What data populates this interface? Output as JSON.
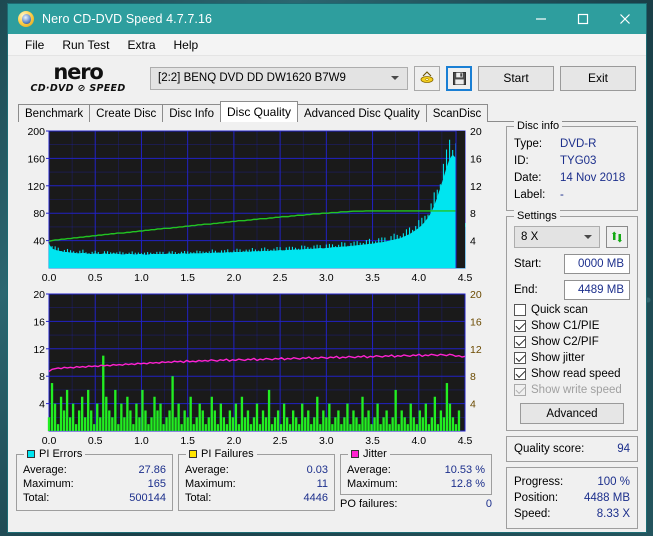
{
  "window": {
    "title": "Nero CD-DVD Speed 4.7.7.16",
    "icon": "nero-disc-icon",
    "minimize": "minimize-icon",
    "maximize": "maximize-icon",
    "close": "close-icon"
  },
  "menu": {
    "items": [
      {
        "label": "File"
      },
      {
        "label": "Run Test"
      },
      {
        "label": "Extra"
      },
      {
        "label": "Help"
      }
    ]
  },
  "toolbar": {
    "brand_top": "nero",
    "brand_bottom": "CD·DVD ⊘ SPEED",
    "drive": "[2:2]   BENQ DVD DD DW1620 B7W9",
    "eject_icon": "eject-disc-icon",
    "save_icon": "save-floppy-icon",
    "start_label": "Start",
    "exit_label": "Exit"
  },
  "tabs": [
    {
      "label": "Benchmark",
      "active": false
    },
    {
      "label": "Create Disc",
      "active": false
    },
    {
      "label": "Disc Info",
      "active": false
    },
    {
      "label": "Disc Quality",
      "active": true
    },
    {
      "label": "Advanced Disc Quality",
      "active": false
    },
    {
      "label": "ScanDisc",
      "active": false
    }
  ],
  "disc_info": {
    "legend": "Disc info",
    "rows": [
      {
        "key": "Type:",
        "value": "DVD-R"
      },
      {
        "key": "ID:",
        "value": "TYG03"
      },
      {
        "key": "Date:",
        "value": "14 Nov 2018"
      },
      {
        "key": "Label:",
        "value": "-"
      }
    ]
  },
  "settings": {
    "legend": "Settings",
    "speed": "8 X",
    "refresh_icon": "refresh-arrows-icon",
    "start_label": "Start:",
    "start_value": "0000 MB",
    "end_label": "End:",
    "end_value": "4489 MB",
    "checkboxes": [
      {
        "label": "Quick scan",
        "checked": false,
        "disabled": false
      },
      {
        "label": "Show C1/PIE",
        "checked": true,
        "disabled": false
      },
      {
        "label": "Show C2/PIF",
        "checked": true,
        "disabled": false
      },
      {
        "label": "Show jitter",
        "checked": true,
        "disabled": false
      },
      {
        "label": "Show read speed",
        "checked": true,
        "disabled": false
      },
      {
        "label": "Show write speed",
        "checked": true,
        "disabled": true
      }
    ],
    "advanced_label": "Advanced"
  },
  "quality": {
    "label": "Quality score:",
    "value": "94"
  },
  "progress": {
    "rows": [
      {
        "key": "Progress:",
        "value": "100 %"
      },
      {
        "key": "Position:",
        "value": "4488 MB"
      },
      {
        "key": "Speed:",
        "value": "8.33 X"
      }
    ]
  },
  "stats": {
    "pi_errors": {
      "legend": "PI Errors",
      "color": "#00e5f0",
      "rows": [
        {
          "key": "Average:",
          "value": "27.86"
        },
        {
          "key": "Maximum:",
          "value": "165"
        },
        {
          "key": "Total:",
          "value": "500144"
        }
      ]
    },
    "pi_failures": {
      "legend": "PI Failures",
      "color": "#ffe400",
      "rows": [
        {
          "key": "Average:",
          "value": "0.03"
        },
        {
          "key": "Maximum:",
          "value": "11"
        },
        {
          "key": "Total:",
          "value": "4446"
        }
      ]
    },
    "jitter": {
      "legend": "Jitter",
      "color": "#ff22d0",
      "rows": [
        {
          "key": "Average:",
          "value": "10.53 %"
        },
        {
          "key": "Maximum:",
          "value": "12.8 %"
        }
      ],
      "po_label": "PO failures:",
      "po_value": "0"
    }
  },
  "chart_data": [
    {
      "type": "area",
      "name": "pie-chart",
      "title": "PI Errors / read speed",
      "xlabel": "",
      "ylabel": "PI Errors",
      "x_ticks": [
        "0.0",
        "0.5",
        "1.0",
        "1.5",
        "2.0",
        "2.5",
        "3.0",
        "3.5",
        "4.0",
        "4.5"
      ],
      "xlim": [
        0,
        4.5
      ],
      "y_ticks_left": [
        "40",
        "80",
        "120",
        "160",
        "200"
      ],
      "ylim_left": [
        0,
        200
      ],
      "y_ticks_right": [
        "4",
        "8",
        "12",
        "16",
        "20"
      ],
      "ylim_right": [
        0,
        20
      ],
      "grid": true,
      "background": "#1a1a1a",
      "grid_color": "#2222cc",
      "series": [
        {
          "name": "PI Errors",
          "color": "#00e5f0",
          "kind": "area",
          "axis": "left",
          "values": [
            34,
            28,
            26,
            25,
            24,
            23,
            23,
            22,
            22,
            21,
            21,
            22,
            21,
            20,
            20,
            21,
            20,
            20,
            21,
            20,
            20,
            21,
            20,
            20,
            19,
            20,
            20,
            20,
            19,
            20,
            20,
            19,
            19,
            20,
            20,
            20,
            20,
            20,
            20,
            21,
            20,
            20,
            20,
            21,
            21,
            20,
            21,
            21,
            21,
            21,
            21,
            22,
            21,
            22,
            22,
            22,
            22,
            22,
            23,
            22,
            23,
            23,
            23,
            23,
            24,
            23,
            24,
            24,
            24,
            24,
            25,
            24,
            25,
            25,
            25,
            26,
            25,
            26,
            26,
            26,
            27,
            26,
            27,
            27,
            28,
            27,
            28,
            28,
            29,
            28,
            29,
            29,
            30,
            30,
            30,
            31,
            31,
            31,
            32,
            32,
            33,
            33,
            34,
            34,
            35,
            35,
            36,
            37,
            37,
            38,
            39,
            40,
            41,
            42,
            43,
            45,
            47,
            49,
            52,
            55,
            58,
            62,
            67,
            73,
            80,
            90,
            102,
            116,
            130,
            145,
            158,
            165,
            160,
            148,
            120,
            60
          ]
        },
        {
          "name": "Read speed",
          "color": "#22c422",
          "kind": "line",
          "axis": "right",
          "values": [
            3.9,
            4.0,
            4.1,
            4.1,
            4.2,
            4.2,
            4.3,
            4.3,
            4.4,
            4.4,
            4.5,
            4.5,
            4.6,
            4.6,
            4.7,
            4.7,
            4.8,
            4.8,
            4.9,
            4.9,
            5.0,
            5.0,
            5.1,
            5.1,
            5.1,
            5.2,
            5.2,
            5.3,
            5.3,
            5.4,
            5.4,
            5.5,
            5.5,
            5.6,
            5.6,
            5.7,
            5.7,
            5.8,
            5.8,
            5.8,
            5.9,
            5.9,
            6.0,
            6.0,
            6.1,
            6.1,
            6.2,
            6.2,
            6.3,
            6.3,
            6.4,
            6.4,
            6.4,
            6.5,
            6.5,
            6.6,
            6.6,
            6.7,
            6.7,
            6.8,
            6.8,
            6.9,
            6.9,
            6.9,
            7.0,
            7.0,
            7.1,
            7.1,
            7.2,
            7.2,
            7.2,
            7.3,
            7.3,
            7.4,
            7.4,
            7.5,
            7.5,
            7.5,
            7.6,
            7.6,
            7.7,
            7.7,
            7.7,
            7.8,
            7.8,
            7.9,
            7.9,
            7.9,
            8.0,
            8.0,
            8.0,
            8.1,
            8.1,
            8.1,
            8.2,
            8.2,
            8.2,
            8.25,
            8.3,
            8.3,
            8.3,
            8.3,
            8.33,
            8.33,
            8.33,
            8.33,
            8.33,
            8.33,
            8.33,
            8.33,
            8.33,
            8.33,
            8.33,
            8.33,
            8.33,
            8.33,
            8.33,
            8.33,
            8.33,
            8.33,
            8.33,
            8.33,
            8.33,
            8.33,
            8.33,
            8.33,
            8.33,
            8.33,
            8.33,
            8.33,
            8.33,
            8.33,
            8.33,
            8.33,
            8.33
          ]
        }
      ]
    },
    {
      "type": "bar",
      "name": "pif-jitter-chart",
      "title": "PI Failures / jitter",
      "xlabel": "",
      "ylabel": "PI Failures",
      "x_ticks": [
        "0.0",
        "0.5",
        "1.0",
        "1.5",
        "2.0",
        "2.5",
        "3.0",
        "3.5",
        "4.0",
        "4.5"
      ],
      "xlim": [
        0,
        4.5
      ],
      "y_ticks_left": [
        "4",
        "8",
        "12",
        "16",
        "20"
      ],
      "ylim_left": [
        0,
        20
      ],
      "y_ticks_right": [
        "4",
        "8",
        "12",
        "16",
        "20"
      ],
      "ylim_right": [
        0,
        20
      ],
      "grid": true,
      "background": "#1a1a1a",
      "grid_color": "#2222cc",
      "series": [
        {
          "name": "PI Failures",
          "color": "#22ee22",
          "kind": "bar",
          "axis": "left",
          "values": [
            2,
            7,
            4,
            1,
            5,
            3,
            6,
            2,
            4,
            1,
            3,
            5,
            2,
            6,
            3,
            1,
            4,
            2,
            11,
            5,
            3,
            2,
            6,
            1,
            4,
            2,
            5,
            3,
            1,
            4,
            2,
            6,
            3,
            1,
            2,
            5,
            3,
            4,
            1,
            2,
            3,
            8,
            2,
            4,
            1,
            3,
            2,
            5,
            1,
            2,
            4,
            3,
            1,
            2,
            5,
            3,
            1,
            4,
            2,
            1,
            3,
            2,
            4,
            1,
            5,
            2,
            3,
            1,
            2,
            4,
            1,
            3,
            2,
            6,
            1,
            2,
            3,
            1,
            4,
            2,
            1,
            3,
            2,
            1,
            4,
            2,
            3,
            1,
            2,
            5,
            1,
            3,
            2,
            4,
            1,
            2,
            3,
            1,
            2,
            4,
            1,
            3,
            2,
            1,
            5,
            2,
            3,
            1,
            2,
            4,
            1,
            2,
            3,
            1,
            2,
            6,
            1,
            3,
            2,
            1,
            4,
            2,
            1,
            3,
            2,
            4,
            1,
            2,
            5,
            1,
            3,
            2,
            7,
            4,
            2,
            1,
            3,
            0,
            0
          ]
        },
        {
          "name": "Jitter",
          "color": "#ff22d0",
          "kind": "line",
          "axis": "right",
          "values": [
            8.7,
            9.0,
            9.1,
            9.2,
            9.1,
            9.3,
            9.2,
            9.3,
            9.2,
            9.4,
            9.3,
            9.4,
            9.3,
            9.5,
            9.4,
            9.5,
            9.4,
            9.6,
            9.5,
            9.6,
            9.5,
            9.7,
            9.6,
            9.7,
            9.6,
            9.8,
            9.7,
            9.8,
            9.7,
            9.9,
            9.8,
            9.9,
            9.8,
            10.0,
            9.9,
            10.0,
            9.9,
            10.1,
            10.0,
            10.1,
            10.0,
            10.2,
            10.1,
            10.2,
            10.0,
            10.3,
            10.1,
            10.2,
            10.1,
            10.3,
            10.2,
            10.3,
            10.2,
            10.4,
            10.3,
            10.2,
            10.4,
            10.3,
            10.5,
            10.2,
            10.4,
            10.3,
            10.5,
            10.4,
            10.3,
            10.5,
            10.4,
            10.6,
            10.3,
            10.5,
            10.4,
            10.6,
            10.5,
            10.4,
            10.6,
            10.5,
            10.7,
            10.4,
            10.6,
            10.5,
            10.7,
            10.6,
            10.5,
            10.7,
            10.6,
            10.8,
            10.5,
            10.7,
            10.6,
            10.8,
            10.7,
            10.6,
            10.8,
            10.7,
            10.9,
            10.6,
            10.8,
            10.7,
            10.9,
            10.8,
            10.7,
            10.9,
            10.8,
            11.0,
            10.7,
            10.9,
            10.8,
            11.0,
            10.9,
            10.8,
            11.0,
            10.9,
            11.1,
            10.8,
            11.0,
            10.9,
            11.1,
            11.0,
            10.9,
            11.1,
            11.0,
            11.2,
            10.9,
            11.1,
            11.0,
            11.2,
            11.1,
            11.0,
            11.2,
            11.1,
            11.0,
            11.2,
            11.1,
            10.9,
            11.0,
            10.8,
            10.9
          ]
        }
      ]
    }
  ]
}
